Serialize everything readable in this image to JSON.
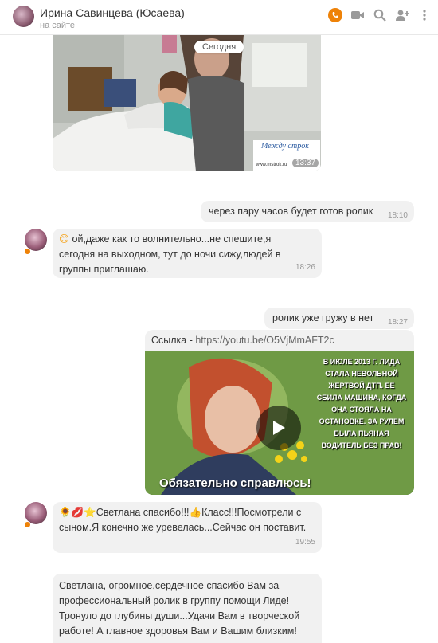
{
  "header": {
    "name": "Ирина Савинцева (Юсаева)",
    "status": "на сайте"
  },
  "photo": {
    "date_pill": "Сегодня",
    "time": "13:37",
    "watermark_title": "Между строк",
    "watermark_url": "www.mstrok.ru"
  },
  "messages": [
    {
      "dir": "out",
      "text": "через пару часов будет готов ролик",
      "time": "18:10"
    },
    {
      "dir": "in",
      "emoji": "😊",
      "text": "ой,даже как то волнительно...не спешите,я сегодня на выходном, тут до ночи сижу,людей в группы приглашаю.",
      "time": "18:26"
    },
    {
      "dir": "out",
      "text": "ролик уже гружу в нет",
      "time": "18:27"
    },
    {
      "dir": "out",
      "type": "link",
      "title_prefix": "Ссылка - ",
      "url": "https://youtu.be/O5VjMmAFT2c",
      "video_text": "В ИЮЛЕ 2013 Г. ЛИДА СТАЛА НЕВОЛЬНОЙ ЖЕРТВОЙ ДТП. ЕЁ СБИЛА МАШИНА, КОГДА ОНА СТОЯЛА НА ОСТАНОВКЕ. ЗА РУЛЁМ БЫЛА ПЬЯНАЯ ВОДИТЕЛЬ БЕЗ ПРАВ!",
      "video_caption": "Обязательно справлюсь!"
    },
    {
      "dir": "in",
      "emoji": "🌻💋⭐",
      "text": "Светлана спасибо!!!👍Класс!!!Посмотрели с сыном.Я конечно же уревелась...Сейчас  он поставит.",
      "time": "19:55"
    },
    {
      "dir": "in",
      "text": "Светлана, огромное,сердечное спасибо Вам за профессиональный ролик в группу помощи Лиде! Тронуло до  глубины души...Удачи Вам в творческой работе! А главное здоровья Вам и Вашим близким!"
    }
  ]
}
